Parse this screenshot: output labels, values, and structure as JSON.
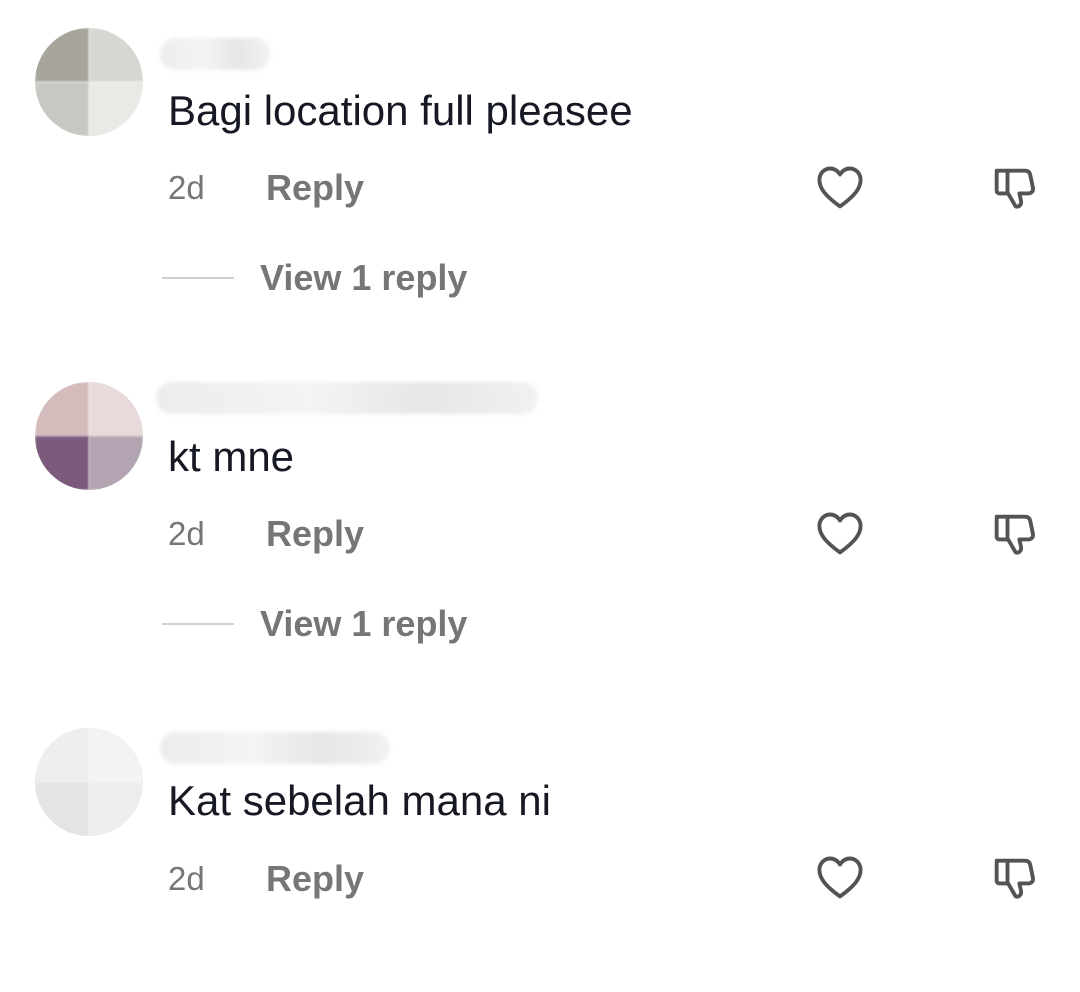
{
  "comments": [
    {
      "text": "Bagi location full pleasee",
      "time": "2d",
      "reply_label": "Reply",
      "view_replies_label": "View 1 reply",
      "avatar_colors": [
        "#a8a59c",
        "#d7d7d2",
        "#c8c8c3",
        "#e9e9e6"
      ]
    },
    {
      "text": "kt mne",
      "time": "2d",
      "reply_label": "Reply",
      "view_replies_label": "View 1 reply",
      "avatar_colors": [
        "#d5bcbc",
        "#e8dada",
        "#7c5a7c",
        "#b2a4b0"
      ]
    },
    {
      "text": "Kat sebelah mana ni",
      "time": "2d",
      "reply_label": "Reply",
      "avatar_colors": [
        "#eeeeee",
        "#f3f3f3",
        "#e4e4e4",
        "#ededed"
      ]
    }
  ],
  "icons": {
    "like": "heart-outline-icon",
    "dislike": "thumbs-down-outline-icon"
  },
  "colors": {
    "text_primary": "#161823",
    "text_secondary": "#767676",
    "icon_stroke": "#545454"
  }
}
